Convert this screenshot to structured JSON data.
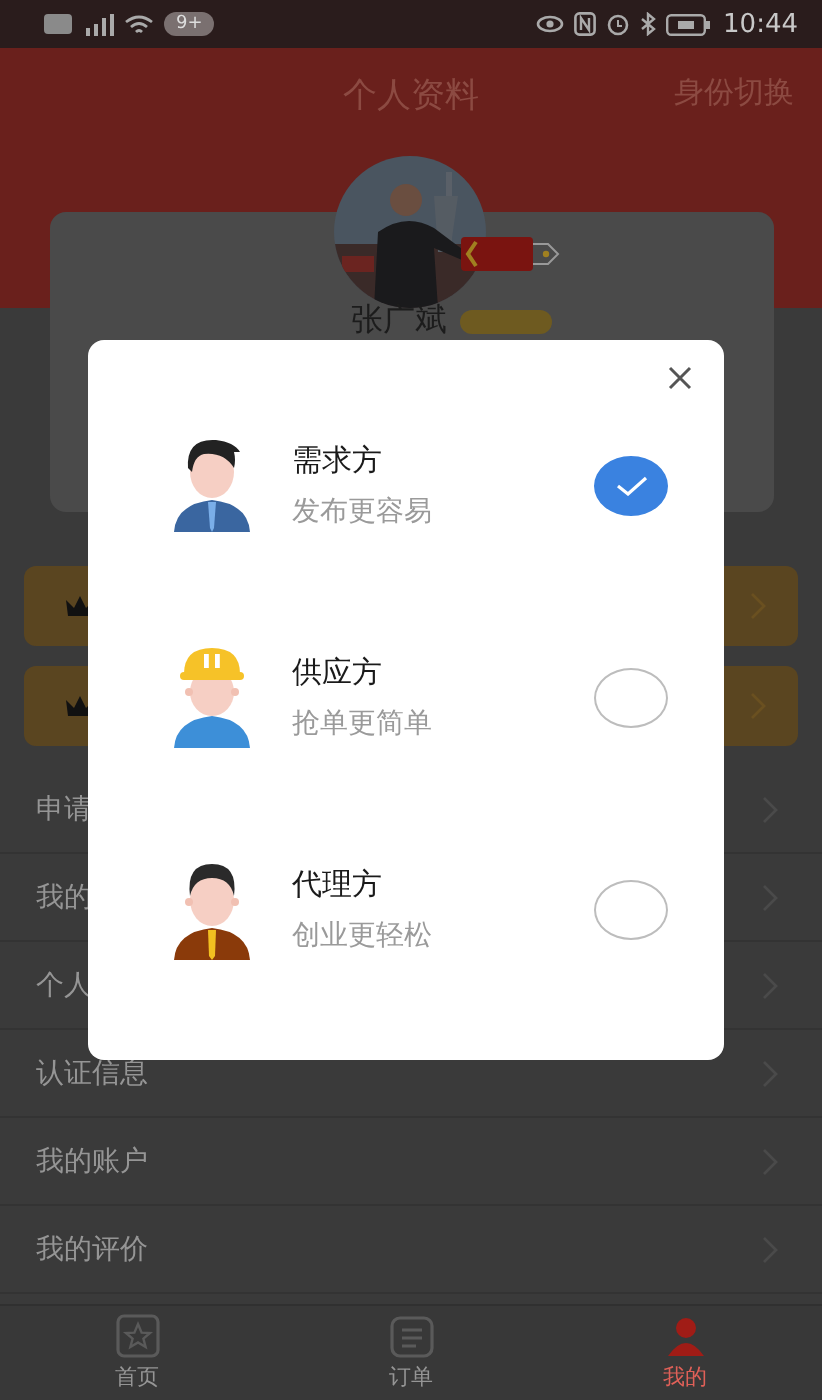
{
  "status_bar": {
    "notification_count": "9+",
    "time": "10:44"
  },
  "header": {
    "title": "个人资料",
    "action": "身份切换"
  },
  "profile": {
    "name": "张广斌"
  },
  "vip_cards": [
    {
      "kind": "crown"
    },
    {
      "kind": "crown"
    }
  ],
  "menu": [
    {
      "label": "申请"
    },
    {
      "label": "我的"
    },
    {
      "label": "个人"
    },
    {
      "label": "认证信息"
    },
    {
      "label": "我的账户"
    },
    {
      "label": "我的评价"
    }
  ],
  "tabs": [
    {
      "kind": "star",
      "label": "首页",
      "selected": false
    },
    {
      "kind": "list",
      "label": "订单",
      "selected": false
    },
    {
      "kind": "person",
      "label": "我的",
      "selected": true
    }
  ],
  "dialog": {
    "options": [
      {
        "kind": "client",
        "title": "需求方",
        "subtitle": "发布更容易",
        "selected": true
      },
      {
        "kind": "worker",
        "title": "供应方",
        "subtitle": "抢单更简单",
        "selected": false
      },
      {
        "kind": "agent",
        "title": "代理方",
        "subtitle": "创业更轻松",
        "selected": false
      }
    ]
  }
}
